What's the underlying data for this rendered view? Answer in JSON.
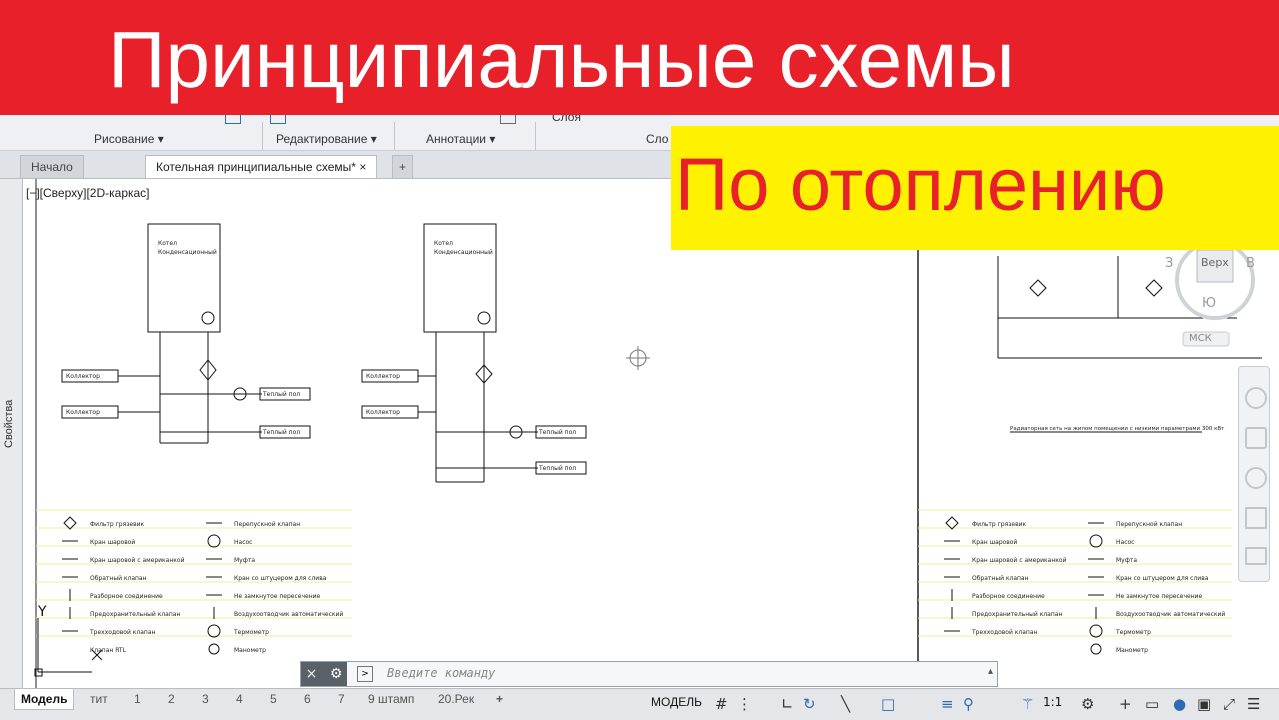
{
  "banner": {
    "title": "Принципиальные схемы",
    "subtitle": "По отоплению"
  },
  "ribbon": {
    "panels": [
      "Рисование",
      "Редактирование",
      "Аннотации",
      "Сло"
    ],
    "layer_label": "Слоя"
  },
  "doc_tabs": {
    "start": "Начало",
    "active": "Котельная принципиальные схемы*",
    "close": "×",
    "new": "+"
  },
  "sidebar": {
    "properties": "Свойства"
  },
  "viewport": {
    "label": "[−][Сверху][2D-каркас]"
  },
  "drawing": {
    "boiler_label_1": "Котел",
    "boiler_label_2": "Конденсационный",
    "manifold_label": "Коллектор",
    "floor_label": "Теплый пол",
    "radiator_note": "Радиаторная сеть на жилом помещении с низкими параметрами 300 кВт",
    "legend_left": [
      "Фильтр грязевик",
      "Кран шаровой",
      "Кран шаровой с американкой",
      "Обратный клапан",
      "Разборное соединение",
      "Предохранительный клапан",
      "Трехходовой клапан",
      "Клапан RTL"
    ],
    "legend_right": [
      "Перепускной клапан",
      "Насос",
      "Муфта",
      "Кран со штуцером для слива",
      "Не замкнутое пересечение",
      "Воздухоотводчик автоматический",
      "Термометр",
      "Манометр"
    ],
    "ucs_y": "Y"
  },
  "viewcube": {
    "top": "Верх",
    "east": "В",
    "south": "Ю",
    "west": "З",
    "wcs": "МСК"
  },
  "command_line": {
    "placeholder": "Введите команду",
    "close_icon": "×",
    "settings_icon": "wrench"
  },
  "layout_tabs": [
    "Модель",
    "тит",
    "1",
    "2",
    "3",
    "4",
    "5",
    "6",
    "7",
    "9 штамп",
    "20.Рек",
    "+"
  ],
  "status_bar": {
    "model": "МОДЕЛЬ",
    "scale": "1:1"
  },
  "colors": {
    "banner_red": "#e8202a",
    "subtitle_bg": "#fff200",
    "accent_blue": "#2d6bb3"
  }
}
